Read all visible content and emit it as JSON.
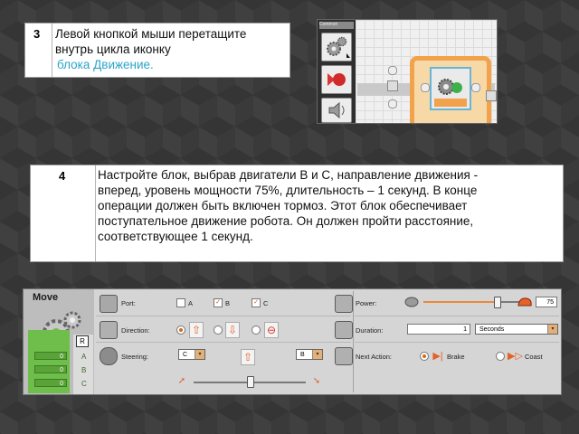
{
  "step3": {
    "number": "3",
    "text_line1": "Левой кнопкой мыши перетащите",
    "text_line2": "внутрь цикла иконку",
    "link_text": "блока Движение."
  },
  "step4": {
    "number": "4",
    "lines": [
      "Настройте блок, выбрав двигатели В и С, направление движения -",
      "вперед, уровень мощности 75%, длительность – 1 секунд. В конце",
      "операции должен быть включен тормоз. Этот блок обеспечивает",
      "поступательное движение робота. Он должен пройти расстояние,",
      "соответствующее 1 секунд."
    ]
  },
  "screenshot": {
    "palette_tab": "Common"
  },
  "move_panel": {
    "title": "Move",
    "port_label": "Port:",
    "ports": [
      {
        "name": "A",
        "checked": false
      },
      {
        "name": "B",
        "checked": true
      },
      {
        "name": "C",
        "checked": true
      }
    ],
    "port_checkmark": "✓",
    "direction_label": "Direction:",
    "steering_label": "Steering:",
    "steering_left_port": "C",
    "steering_right_port": "B",
    "steering_level": 0.5,
    "power_label": "Power:",
    "power_value": "75",
    "power_level": 0.75,
    "duration_label": "Duration:",
    "duration_value": "1",
    "duration_unit": "Seconds",
    "next_action_label": "Next Action:",
    "brake_label": "Brake",
    "coast_label": "Coast",
    "selected_next_action": "Brake",
    "feedback_port_r": "R",
    "feedback": [
      {
        "value": "0",
        "port": "A"
      },
      {
        "value": "0",
        "port": "B"
      },
      {
        "value": "0",
        "port": "C"
      }
    ],
    "dropdown_arrow": "▾",
    "arrow_up": "⇧",
    "arrow_down": "⇩",
    "stop_symbol": "⊖",
    "colors": {
      "accent_orange": "#e98a3a",
      "green_strip": "#6fbd4a",
      "link_blue": "#2aa6c8"
    }
  }
}
